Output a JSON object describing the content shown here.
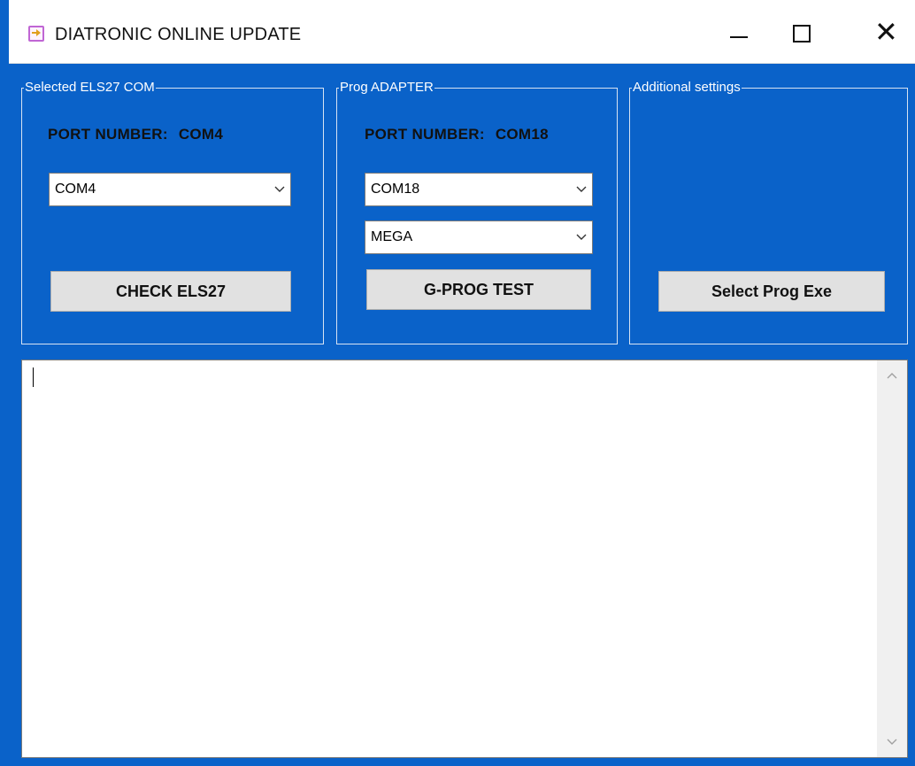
{
  "window": {
    "title": "DIATRONIC ONLINE UPDATE",
    "icon": "app-update-icon"
  },
  "groups": {
    "els27": {
      "legend": "Selected ELS27 COM",
      "port_label": "PORT NUMBER:",
      "port_value": "COM4",
      "combo_value": "COM4",
      "button_label": "CHECK ELS27"
    },
    "prog_adapter": {
      "legend": "Prog ADAPTER",
      "port_label": "PORT NUMBER:",
      "port_value": "COM18",
      "combo_port_value": "COM18",
      "combo_type_value": "MEGA",
      "button_label": "G-PROG TEST"
    },
    "additional": {
      "legend": "Additional settings",
      "button_label": "Select Prog Exe"
    }
  },
  "output": {
    "text": ""
  },
  "colors": {
    "window_bg": "#0a62c9",
    "button_bg": "#e1e1e1",
    "titlebar_bg": "#ffffff"
  }
}
